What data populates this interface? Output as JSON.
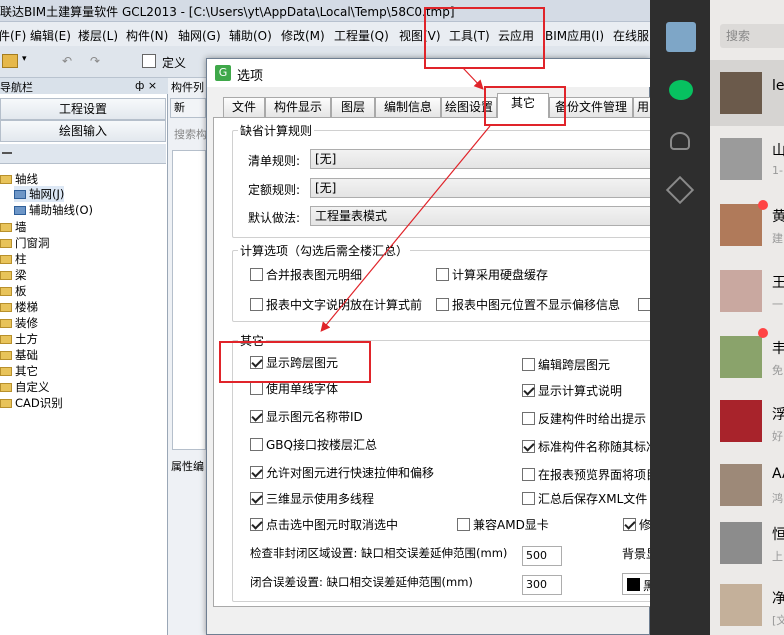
{
  "app": {
    "title": "联达BIM土建算量软件 GCL2013 - [C:\\Users\\yt\\AppData\\Local\\Temp\\58C0.tmp]"
  },
  "menu": [
    "件(F)",
    "编辑(E)",
    "楼层(L)",
    "构件(N)",
    "轴网(G)",
    "辅助(O)",
    "修改(M)",
    "工程量(Q)",
    "视图(V)",
    "工具(T)",
    "云应用",
    "BIM应用(I)",
    "在线服"
  ],
  "toolbar": {
    "define": "定义"
  },
  "nav": {
    "header": "导航栏",
    "header2": "构件列",
    "pin": "ф ×",
    "project_settings": "工程设置",
    "drawing_input": "绘图输入",
    "search_placeholder": "搜索构",
    "props": "属性编",
    "new": "新",
    "tree": [
      {
        "label": "轴线",
        "level": 0,
        "type": "folder"
      },
      {
        "label": "轴网(J)",
        "level": 1,
        "type": "grid"
      },
      {
        "label": "辅助轴线(O)",
        "level": 1,
        "type": "grid"
      },
      {
        "label": "墙",
        "level": 0,
        "type": "folder"
      },
      {
        "label": "门窗洞",
        "level": 0,
        "type": "folder"
      },
      {
        "label": "柱",
        "level": 0,
        "type": "folder"
      },
      {
        "label": "梁",
        "level": 0,
        "type": "folder"
      },
      {
        "label": "板",
        "level": 0,
        "type": "folder"
      },
      {
        "label": "楼梯",
        "level": 0,
        "type": "folder"
      },
      {
        "label": "装修",
        "level": 0,
        "type": "folder"
      },
      {
        "label": "土方",
        "level": 0,
        "type": "folder"
      },
      {
        "label": "基础",
        "level": 0,
        "type": "folder"
      },
      {
        "label": "其它",
        "level": 0,
        "type": "folder"
      },
      {
        "label": "自定义",
        "level": 0,
        "type": "folder"
      },
      {
        "label": "CAD识别",
        "level": 0,
        "type": "folder"
      }
    ]
  },
  "dialog": {
    "title": "选项",
    "tabs": [
      "文件",
      "构件显示",
      "图层",
      "编制信息",
      "绘图设置",
      "其它",
      "备份文件管理",
      "用"
    ],
    "active_tab": "其它",
    "default_rules": {
      "title": "缺省计算规则",
      "list_rule_label": "清单规则:",
      "list_rule_value": "[无]",
      "quota_rule_label": "定额规则:",
      "quota_rule_value": "[无]",
      "default_method_label": "默认做法:",
      "default_method_value": "工程量表模式"
    },
    "calc_options": {
      "title": "计算选项（勾选后需全楼汇总）",
      "items": [
        {
          "label": "合并报表图元明细",
          "checked": false
        },
        {
          "label": "计算采用硬盘缓存",
          "checked": false
        },
        {
          "label": "报表中文字说明放在计算式前",
          "checked": false
        },
        {
          "label": "报表中图元位置不显示偏移信息",
          "checked": false
        }
      ]
    },
    "other": {
      "title": "其它",
      "left": [
        {
          "label": "显示跨层图元",
          "checked": true
        },
        {
          "label": "使用单线字体",
          "checked": false
        },
        {
          "label": "显示图元名称带ID",
          "checked": true
        },
        {
          "label": "GBQ接口按楼层汇总",
          "checked": false
        },
        {
          "label": "允许对图元进行快速拉伸和偏移",
          "checked": true
        },
        {
          "label": "三维显示使用多线程",
          "checked": true
        },
        {
          "label": "点击选中图元时取消选中",
          "checked": true
        }
      ],
      "right": [
        {
          "label": "编辑跨层图元",
          "checked": false
        },
        {
          "label": "显示计算式说明",
          "checked": true
        },
        {
          "label": "反建构件时给出提示",
          "checked": false
        },
        {
          "label": "标准构件名称随其标准",
          "checked": true
        },
        {
          "label": "在报表预览界面将项目",
          "checked": false
        },
        {
          "label": "汇总后保存XML文件",
          "checked": false
        }
      ],
      "amd": {
        "label": "兼容AMD显卡",
        "checked": false
      },
      "modify": {
        "label": "修",
        "checked": true
      },
      "non_closed_label": "检查非封闭区域设置: 缺口相交误差延伸范围(mm)",
      "non_closed_value": "500",
      "background_label": "背景显",
      "close_label": "闭合误差设置: 缺口相交误差延伸范围(mm)",
      "close_value": "300",
      "black": "黑"
    }
  },
  "chat": {
    "search": "搜索",
    "items": [
      {
        "name": "le",
        "preview": ""
      },
      {
        "name": "山",
        "preview": "1-"
      },
      {
        "name": "黄",
        "preview": "建"
      },
      {
        "name": "王",
        "preview": "一"
      },
      {
        "name": "丰",
        "preview": "免"
      },
      {
        "name": "浮",
        "preview": "好"
      },
      {
        "name": "AA",
        "preview": "鸿"
      },
      {
        "name": "恒",
        "preview": "上"
      },
      {
        "name": "净",
        "preview": "[文"
      }
    ]
  },
  "colors": {
    "annotation_red": "#e0242a",
    "wechat_green": "#07c160"
  }
}
